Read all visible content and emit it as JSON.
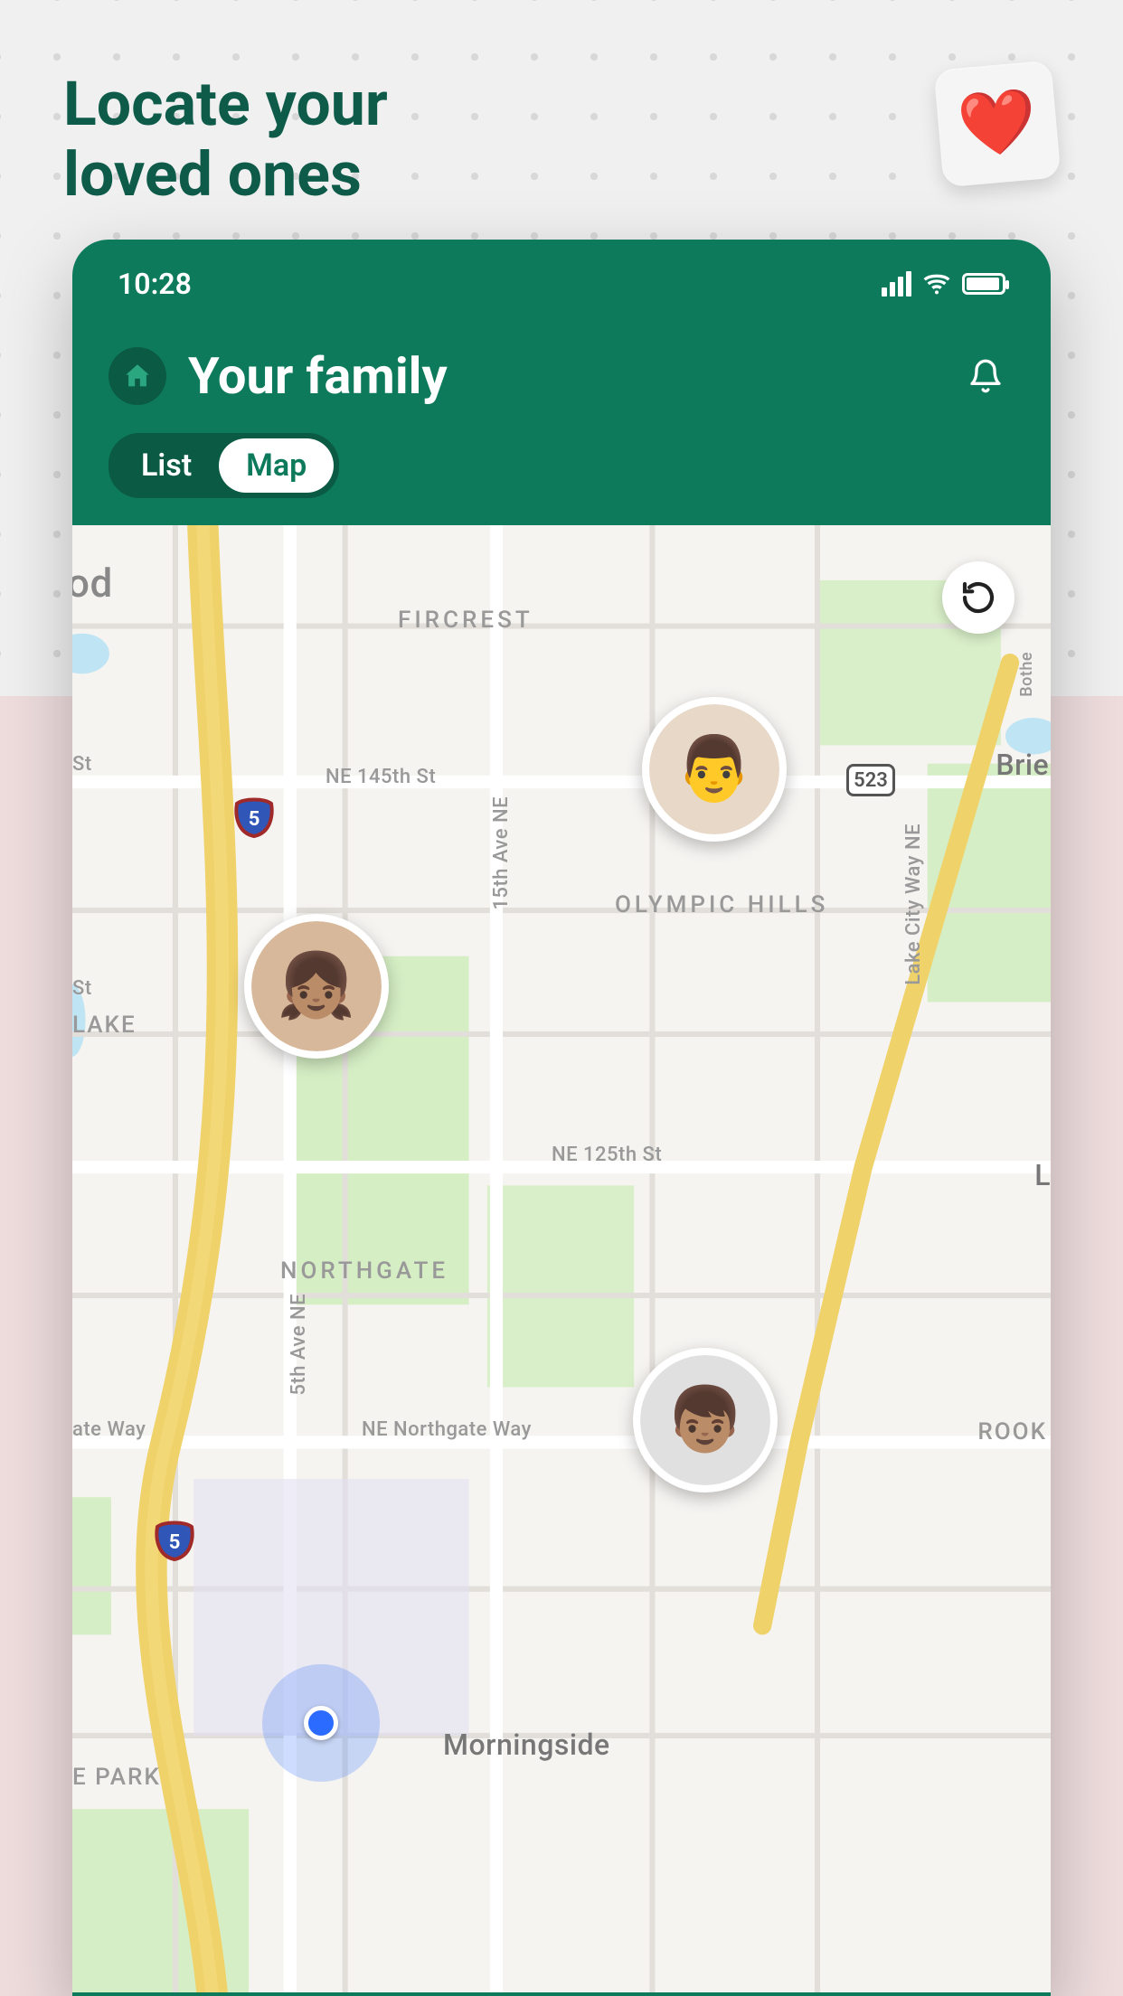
{
  "promo": {
    "heading_line1": "Locate your",
    "heading_line2": "loved ones",
    "heart_emoji": "❤️"
  },
  "status": {
    "time": "10:28"
  },
  "header": {
    "title": "Your family"
  },
  "toggle": {
    "list_label": "List",
    "map_label": "Map",
    "active": "map"
  },
  "map": {
    "labels": {
      "wood_partial": "od",
      "fircrest": "FIRCREST",
      "st_1": "St",
      "ne_145th": "NE 145th St",
      "brier": "Brier",
      "olympic_hills": "OLYMPIC HILLS",
      "st_2": "St",
      "lake": "LAKE",
      "ne_125th": "NE 125th St",
      "la_partial": "L",
      "northgate": "NORTHGATE",
      "ave_5th_ne": "5th Ave NE",
      "ave_15th_ne": "15th Ave NE",
      "lake_city_way": "Lake City Way NE",
      "ate_way": "ate Way",
      "ne_northgate_way": "NE Northgate Way",
      "rook": "ROOK",
      "morningside": "Morningside",
      "e_park": "E PARK",
      "bothe": "Bothe"
    },
    "shields": {
      "i5": "5",
      "route_523": "523"
    },
    "avatars": [
      {
        "id": "member-1",
        "emoji": "👨",
        "bg": "#e8d8c8"
      },
      {
        "id": "member-2",
        "emoji": "👧🏽",
        "bg": "#d8b89a"
      },
      {
        "id": "member-3",
        "emoji": "👦🏽",
        "bg": "#e0e0e0"
      }
    ]
  },
  "colors": {
    "brand_green": "#0e7a5c",
    "brand_dark": "#0a5a44",
    "heading_green": "#0e5b4a"
  }
}
